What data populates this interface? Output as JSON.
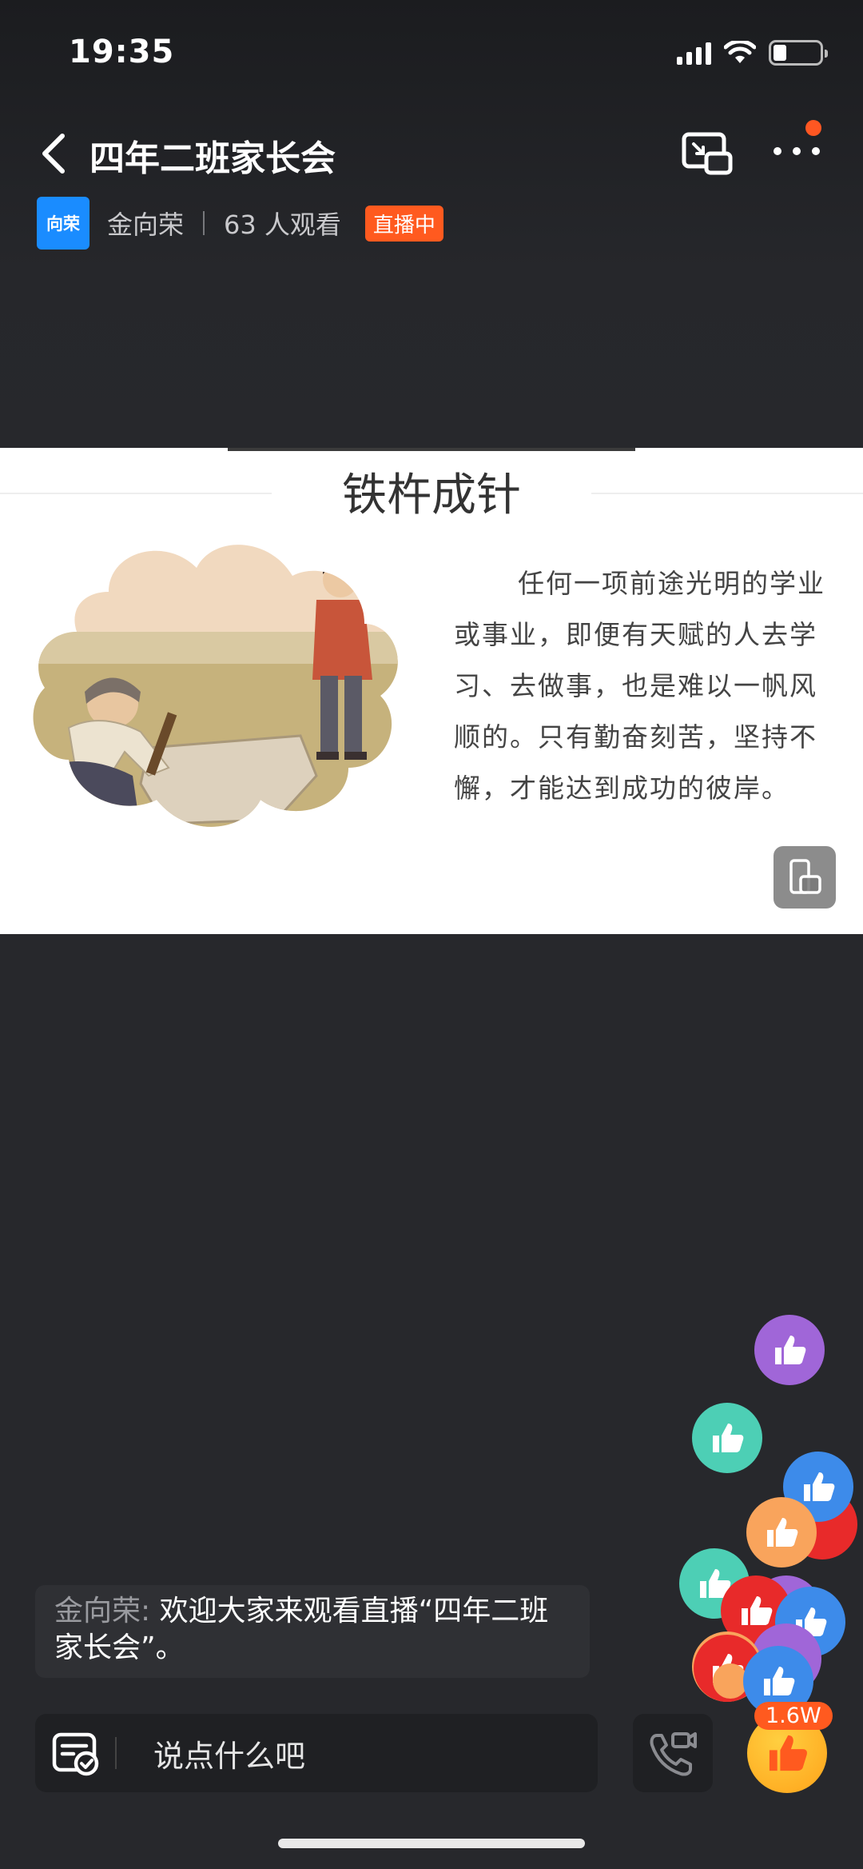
{
  "status_bar": {
    "time": "19:35"
  },
  "header": {
    "title": "四年二班家长会"
  },
  "anchor": {
    "avatar_text": "向荣",
    "name": "金向荣",
    "viewers": "63 人观看",
    "live_badge": "直播中"
  },
  "slide": {
    "title": "铁杵成针",
    "paragraph": "任何一项前途光明的学业或事业，即便有天赋的人去学习、去做事，也是难以一帆风顺的。只有勤奋刻苦，坚持不懈，才能达到成功的彼岸。"
  },
  "chat": {
    "user": "金向荣:",
    "message": " 欢迎大家来观看直播“四年二班家长会”。"
  },
  "bottom_bar": {
    "input_placeholder": "说点什么吧",
    "like_count": "1.6W"
  },
  "colors": {
    "live_badge": "#ff5a1f",
    "avatar": "#1a8cff",
    "like_button": "#ffa31a",
    "bubble_purple": "#a066d8",
    "bubble_teal": "#4dcfb5",
    "bubble_blue": "#3d8bea",
    "bubble_orange": "#f9a45c",
    "bubble_red": "#e82a2a"
  },
  "icons": {
    "back": "chevron-left-icon",
    "screen": "screen-cast-icon",
    "more": "more-dots-icon",
    "rotate": "rotate-screen-icon",
    "notice": "notice-check-icon",
    "call": "video-call-icon",
    "like": "thumbs-up-icon"
  }
}
